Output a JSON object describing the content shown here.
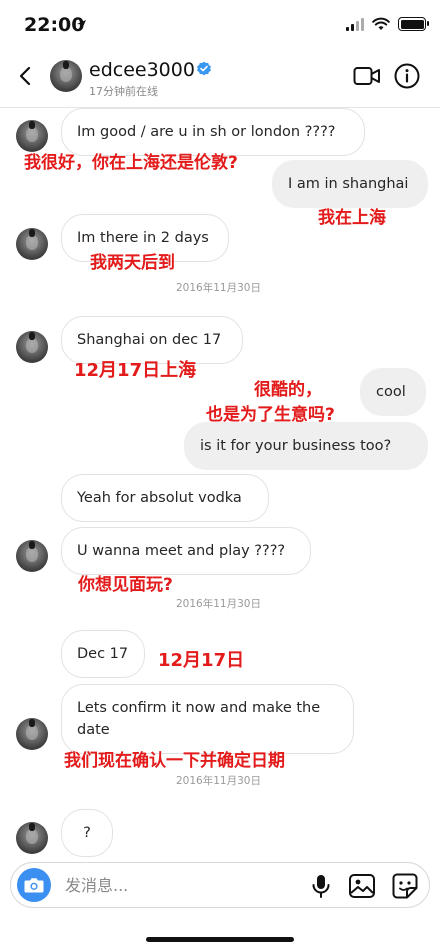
{
  "status_bar": {
    "time": "22:00"
  },
  "header": {
    "username": "edcee3000",
    "active_status": "17分钟前在线",
    "icons": [
      "back-arrow-icon",
      "verified-badge-icon",
      "video-call-icon",
      "info-icon"
    ]
  },
  "messages": [
    {
      "text": "Im good / are u in sh or london ????",
      "annotation": "我很好，你在上海还是伦敦?"
    },
    {
      "text": "I am in shanghai",
      "annotation": "我在上海"
    },
    {
      "text": "Im there in 2 days",
      "annotation": "我两天后到"
    },
    {
      "text": "Shanghai on dec 17",
      "annotation": "12月17日上海"
    },
    {
      "text": "cool",
      "annotation_line1": "很酷的，",
      "annotation_line2": "也是为了生意吗?"
    },
    {
      "text": "is it for your business too?"
    },
    {
      "text": "Yeah for absolut vodka"
    },
    {
      "text": "U wanna meet and play ????",
      "annotation": "你想见面玩?"
    },
    {
      "text": "Dec 17",
      "annotation": "12月17日"
    },
    {
      "text": "Lets confirm it now and make the date",
      "annotation": "我们现在确认一下并确定日期"
    },
    {
      "text": "?"
    }
  ],
  "timestamps": [
    "2016年11月30日",
    "2016年11月30日",
    "2016年11月30日"
  ],
  "composer": {
    "placeholder": "发消息..."
  },
  "colors": {
    "annotation": "#e31b1b",
    "verified": "#3897f0",
    "camera": "#3b8ff0",
    "outgoing_bubble": "#efefef"
  }
}
